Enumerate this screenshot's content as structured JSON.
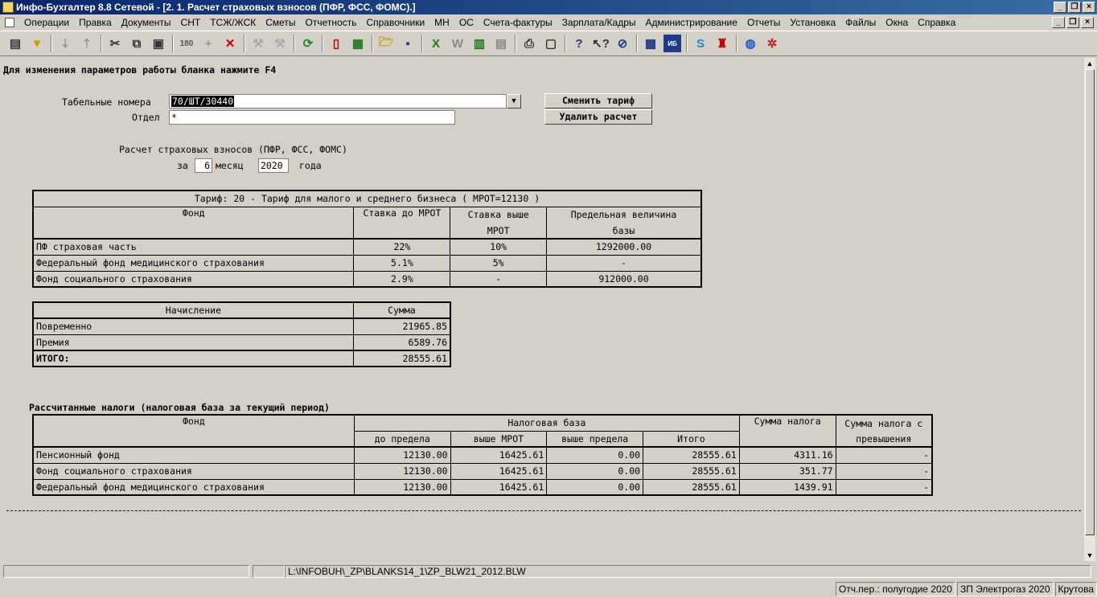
{
  "window": {
    "title": "Инфо-Бухгалтер 8.8 Сетевой - [2. 1. Расчет страховых взносов (ПФР, ФСС, ФОМС).]"
  },
  "menu": [
    "Операции",
    "Правка",
    "Документы",
    "СНТ",
    "ТСЖ/ЖСК",
    "Сметы",
    "Отчетность",
    "Справочники",
    "МН",
    "ОС",
    "Счета-фактуры",
    "Зарплата/Кадры",
    "Администрирование",
    "Отчеты",
    "Установка",
    "Файлы",
    "Окна",
    "Справка"
  ],
  "toolbar_icons": [
    "form-icon",
    "filter-icon",
    "sort-asc-icon",
    "sort-desc-icon",
    "cut-icon",
    "copy-icon",
    "paste-icon",
    "rotate-icon",
    "add-icon",
    "delete-icon",
    "tool1-icon",
    "tool2-icon",
    "refresh-icon",
    "pdf-icon",
    "calculator-icon",
    "open-folder-icon",
    "save-icon",
    "excel-icon",
    "word-icon",
    "chart-icon",
    "report-icon",
    "print-icon",
    "preview-icon",
    "help-icon",
    "context-help-icon",
    "navigate-icon",
    "grid-icon",
    "ib10-icon",
    "skype-icon",
    "security-icon",
    "network-icon",
    "settings-icon"
  ],
  "form": {
    "hint": "Для изменения параметров работы бланка нажмите F4",
    "tabnum_label": "Табельные номера",
    "tabnum_value": "70/ШТ/30440",
    "dept_label": "Отдел",
    "dept_value": "*",
    "change_tariff_btn": "Сменить тариф",
    "delete_calc_btn": "Удалить расчет",
    "calc_title": "Расчет страховых взносов (ПФР, ФСС, ФОМС)",
    "za": "за",
    "month": "6",
    "month_word": "месяц",
    "year": "2020",
    "year_word": "года"
  },
  "tariff_table": {
    "title": "Тариф: 20 - Тариф для малого и среднего бизнеса ( МРОТ=12130 )",
    "headers": [
      "Фонд",
      "Ставка до МРОТ",
      "Ставка выше",
      "МРОТ",
      "Предельная величина",
      "базы"
    ],
    "rows": [
      [
        "ПФ страховая часть",
        "22%",
        "10%",
        "1292000.00"
      ],
      [
        "Федеральный фонд медицинского страхования",
        "5.1%",
        "5%",
        "-"
      ],
      [
        "Фонд социального страхования",
        "2.9%",
        "-",
        "912000.00"
      ]
    ]
  },
  "accrual_table": {
    "headers": [
      "Начисление",
      "Сумма"
    ],
    "rows": [
      [
        "Повременно",
        "21965.85"
      ],
      [
        "Премия",
        "6589.76"
      ]
    ],
    "total": [
      "ИТОГО:",
      "28555.61"
    ]
  },
  "taxes_table": {
    "title": "Рассчитанные налоги (налоговая база за текущий период)",
    "headers": [
      "Фонд",
      "Налоговая база",
      "Сумма налога",
      "Сумма налога с",
      "превышения",
      "до предела",
      "выше МРОТ",
      "выше предела",
      "Итого"
    ],
    "rows": [
      [
        "Пенсионный фонд",
        "12130.00",
        "16425.61",
        "0.00",
        "28555.61",
        "4311.16",
        "-"
      ],
      [
        "Фонд социального страхования",
        "12130.00",
        "16425.61",
        "0.00",
        "28555.61",
        "351.77",
        "-"
      ],
      [
        "Федеральный фонд медицинского страхования",
        "12130.00",
        "16425.61",
        "0.00",
        "28555.61",
        "1439.91",
        "-"
      ]
    ]
  },
  "path": "L:\\INFOBUH\\_ZP\\BLANKS14_1\\ZP_BLW21_2012.BLW",
  "status": {
    "period": "Отч.пер.: полугодие 2020",
    "org": "ЗП Электрогаз 2020",
    "user": "Крутова"
  }
}
